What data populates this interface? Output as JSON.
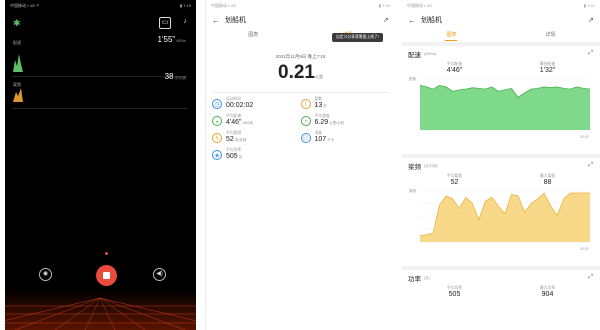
{
  "panel1": {
    "status_left": "中国移动 ▪ 4G ⁿ⁶",
    "status_right": "▮ 7:19",
    "pace_label": "配速",
    "pace_value": "1'55\"",
    "pace_unit": "/500m",
    "rate_label": "桨频",
    "rate_value": "38",
    "rate_unit": "次/分钟",
    "colors": {
      "accent_green": "#5fbf6a",
      "accent_orange": "#d9972e",
      "stop_red": "#e84b3c",
      "floor_glow": "#ff4a1a"
    }
  },
  "panel2": {
    "status_left": "中国移动 ▪ 4G",
    "status_right": "▮ 7:19",
    "title": "划船机",
    "tabs": [
      "图表",
      "详情"
    ],
    "active_tab": 1,
    "tooltip": "自定义分享背景图上线了!",
    "date": "2021年11月9日 晚上7:18",
    "distance": "0.21",
    "distance_unit": "公里",
    "stats": [
      {
        "label": "运动时间",
        "value": "00:02:02",
        "unit": "",
        "icon": "clock-icon",
        "color": "#3a8ee6"
      },
      {
        "label": "桨数",
        "value": "13",
        "unit": "次",
        "icon": "paddle-icon",
        "color": "#e8a431"
      },
      {
        "label": "平均配速",
        "value": "4'46\"",
        "unit": "/500米",
        "icon": "speed-icon",
        "color": "#4cae4f"
      },
      {
        "label": "平均速度",
        "value": "6.29",
        "unit": "公里/小时",
        "icon": "speedometer-icon",
        "color": "#4cae4f"
      },
      {
        "label": "平均桨频",
        "value": "52",
        "unit": "次/分钟",
        "icon": "bolt-icon",
        "color": "#e8a431"
      },
      {
        "label": "消耗",
        "value": "107",
        "unit": "千卡",
        "icon": "calorie-icon",
        "color": "#3a8ee6"
      },
      {
        "label": "平均功率",
        "value": "505",
        "unit": "瓦",
        "icon": "power-icon",
        "color": "#3a8ee6"
      }
    ]
  },
  "panel3": {
    "status_left": "中国移动 ▪ 4G",
    "status_right": "▮ 7:21",
    "title": "划船机",
    "tabs": [
      "图表",
      "详情"
    ],
    "active_tab": 0,
    "cards": [
      {
        "title": "配速",
        "unit": "(/500m)",
        "left_label": "平均配速",
        "left_value": "4'46\"",
        "right_label": "最快配速",
        "right_value": "1'32\"",
        "axis_label": "配速",
        "x_end": "02:02",
        "fill": "#7ed98a",
        "stroke": "#4cae4f"
      },
      {
        "title": "桨频",
        "unit": "(次/分钟)",
        "left_label": "平均桨频",
        "left_value": "52",
        "right_label": "最大桨频",
        "right_value": "88",
        "axis_label": "桨频",
        "x_end": "02:02",
        "fill": "#f8d98a",
        "stroke": "#eab43a"
      },
      {
        "title": "功率",
        "unit": "(瓦)",
        "left_label": "平均功率",
        "left_value": "505",
        "right_label": "最大功率",
        "right_value": "904"
      }
    ]
  },
  "chart_data": [
    {
      "type": "area",
      "ylabel": "配速",
      "x": [
        "0:00",
        "02:02"
      ],
      "series": [
        {
          "values": [
            60,
            58,
            55,
            60,
            58,
            52,
            54,
            55,
            57,
            56,
            55,
            58,
            52,
            54,
            56,
            44,
            50,
            55,
            56,
            58,
            57,
            58,
            56,
            55,
            58,
            56,
            55
          ]
        }
      ]
    },
    {
      "type": "area",
      "ylabel": "桨频",
      "x": [
        "0:00",
        "02:02"
      ],
      "series": [
        {
          "values": [
            8,
            10,
            12,
            50,
            62,
            58,
            45,
            60,
            52,
            30,
            55,
            60,
            48,
            38,
            64,
            62,
            40,
            52,
            58,
            66,
            48,
            36,
            58,
            66,
            66,
            66,
            66
          ]
        }
      ]
    }
  ]
}
